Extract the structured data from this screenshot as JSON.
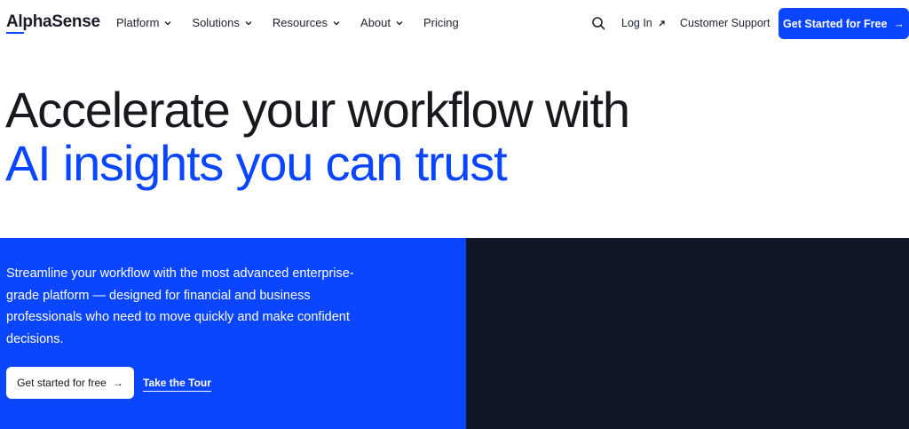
{
  "brand": {
    "logo_text": "AlphaSense",
    "accent_color": "#0a45ff",
    "dark_color": "#111726"
  },
  "nav": {
    "items": [
      {
        "label": "Platform",
        "has_dropdown": true
      },
      {
        "label": "Solutions",
        "has_dropdown": true
      },
      {
        "label": "Resources",
        "has_dropdown": true
      },
      {
        "label": "About",
        "has_dropdown": true
      },
      {
        "label": "Pricing",
        "has_dropdown": false
      }
    ],
    "search_icon": "search-icon",
    "login_label": "Log In",
    "support_label": "Customer Support",
    "cta_label": "Get Started for Free",
    "cta_arrow": "→"
  },
  "hero": {
    "headline_line1": "Accelerate your workflow with",
    "headline_line2": "AI insights you can trust",
    "subtext": "Streamline your workflow with the most advanced enterprise-grade platform — designed for financial and business professionals who need to move quickly and make confident decisions.",
    "primary_button": "Get started for free",
    "primary_arrow": "→",
    "secondary_link": "Take the Tour"
  }
}
